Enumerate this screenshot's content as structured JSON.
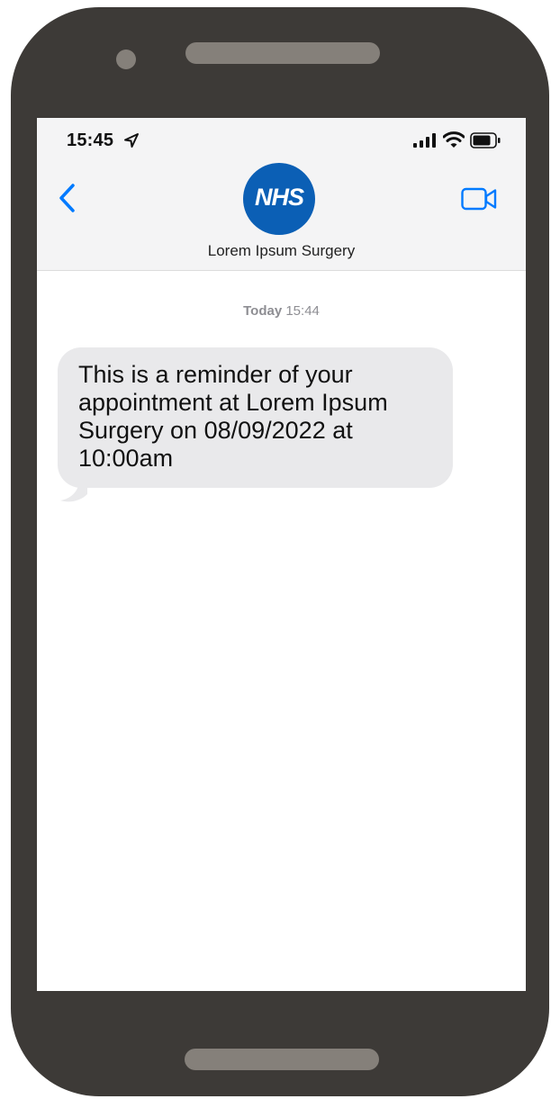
{
  "status_bar": {
    "time": "15:45",
    "icons": [
      "location-arrow-icon",
      "signal-bars-icon",
      "wifi-icon",
      "battery-icon"
    ]
  },
  "header": {
    "back_icon": "chevron-left-icon",
    "avatar_text": "NHS",
    "contact_name": "Lorem Ipsum Surgery",
    "video_icon": "video-camera-icon"
  },
  "conversation": {
    "timestamp_day": "Today",
    "timestamp_time": "15:44",
    "messages": [
      {
        "text": "This is a reminder of your appointment at Lorem Ipsum Surgery on 08/09/2022 at 10:00am"
      }
    ]
  },
  "colors": {
    "phone_body": "#3d3a37",
    "phone_details": "#85807a",
    "accent_blue": "#007aff",
    "nhs_blue": "#0b5fb5",
    "bubble_gray": "#e9e9eb",
    "header_bg": "#f4f4f5"
  }
}
